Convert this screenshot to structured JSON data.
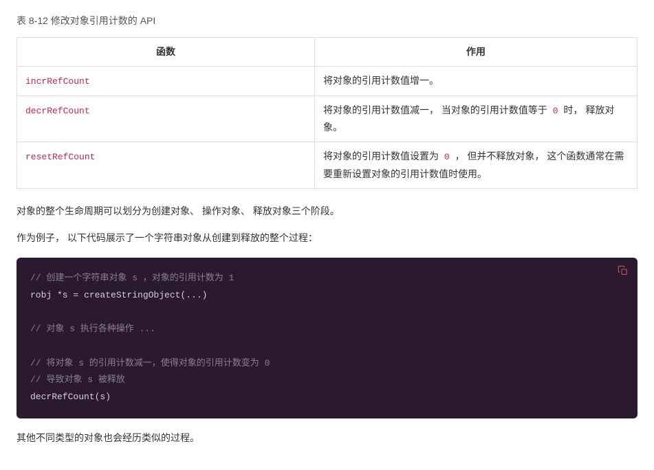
{
  "caption": "表 8-12 修改对象引用计数的 API",
  "table": {
    "headers": [
      "函数",
      "作用"
    ],
    "rows": [
      {
        "fn": "incrRefCount",
        "desc_parts": [
          "将对象的引用计数值增一。"
        ]
      },
      {
        "fn": "decrRefCount",
        "desc_parts": [
          "将对象的引用计数值减一， 当对象的引用计数值等于 ",
          "0",
          " 时， 释放对象。"
        ]
      },
      {
        "fn": "resetRefCount",
        "desc_parts": [
          "将对象的引用计数值设置为 ",
          "0",
          " ， 但并不释放对象， 这个函数通常在需要重新设置对象的引用计数值时使用。"
        ]
      }
    ]
  },
  "para1": "对象的整个生命周期可以划分为创建对象、 操作对象、 释放对象三个阶段。",
  "para2": "作为例子， 以下代码展示了一个字符串对象从创建到释放的整个过程：",
  "code": {
    "c1": "// 创建一个字符串对象 s ，对象的引用计数为 1",
    "l1": "robj *s = createStringObject(...)",
    "c2": "// 对象 s 执行各种操作 ...",
    "c3": "// 将对象 s 的引用计数减一，使得对象的引用计数变为 0",
    "c4": "// 导致对象 s 被释放",
    "l2": "decrRefCount(s)"
  },
  "para3": "其他不同类型的对象也会经历类似的过程。"
}
